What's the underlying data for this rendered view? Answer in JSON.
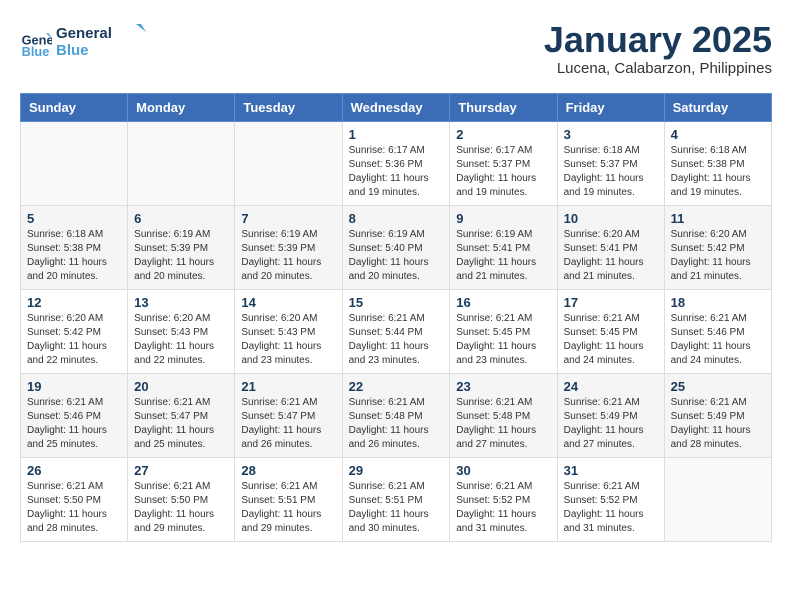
{
  "header": {
    "logo_line1": "General",
    "logo_line2": "Blue",
    "month": "January 2025",
    "location": "Lucena, Calabarzon, Philippines"
  },
  "weekdays": [
    "Sunday",
    "Monday",
    "Tuesday",
    "Wednesday",
    "Thursday",
    "Friday",
    "Saturday"
  ],
  "weeks": [
    [
      {
        "day": "",
        "sunrise": "",
        "sunset": "",
        "daylight": ""
      },
      {
        "day": "",
        "sunrise": "",
        "sunset": "",
        "daylight": ""
      },
      {
        "day": "",
        "sunrise": "",
        "sunset": "",
        "daylight": ""
      },
      {
        "day": "1",
        "sunrise": "Sunrise: 6:17 AM",
        "sunset": "Sunset: 5:36 PM",
        "daylight": "Daylight: 11 hours and 19 minutes."
      },
      {
        "day": "2",
        "sunrise": "Sunrise: 6:17 AM",
        "sunset": "Sunset: 5:37 PM",
        "daylight": "Daylight: 11 hours and 19 minutes."
      },
      {
        "day": "3",
        "sunrise": "Sunrise: 6:18 AM",
        "sunset": "Sunset: 5:37 PM",
        "daylight": "Daylight: 11 hours and 19 minutes."
      },
      {
        "day": "4",
        "sunrise": "Sunrise: 6:18 AM",
        "sunset": "Sunset: 5:38 PM",
        "daylight": "Daylight: 11 hours and 19 minutes."
      }
    ],
    [
      {
        "day": "5",
        "sunrise": "Sunrise: 6:18 AM",
        "sunset": "Sunset: 5:38 PM",
        "daylight": "Daylight: 11 hours and 20 minutes."
      },
      {
        "day": "6",
        "sunrise": "Sunrise: 6:19 AM",
        "sunset": "Sunset: 5:39 PM",
        "daylight": "Daylight: 11 hours and 20 minutes."
      },
      {
        "day": "7",
        "sunrise": "Sunrise: 6:19 AM",
        "sunset": "Sunset: 5:39 PM",
        "daylight": "Daylight: 11 hours and 20 minutes."
      },
      {
        "day": "8",
        "sunrise": "Sunrise: 6:19 AM",
        "sunset": "Sunset: 5:40 PM",
        "daylight": "Daylight: 11 hours and 20 minutes."
      },
      {
        "day": "9",
        "sunrise": "Sunrise: 6:19 AM",
        "sunset": "Sunset: 5:41 PM",
        "daylight": "Daylight: 11 hours and 21 minutes."
      },
      {
        "day": "10",
        "sunrise": "Sunrise: 6:20 AM",
        "sunset": "Sunset: 5:41 PM",
        "daylight": "Daylight: 11 hours and 21 minutes."
      },
      {
        "day": "11",
        "sunrise": "Sunrise: 6:20 AM",
        "sunset": "Sunset: 5:42 PM",
        "daylight": "Daylight: 11 hours and 21 minutes."
      }
    ],
    [
      {
        "day": "12",
        "sunrise": "Sunrise: 6:20 AM",
        "sunset": "Sunset: 5:42 PM",
        "daylight": "Daylight: 11 hours and 22 minutes."
      },
      {
        "day": "13",
        "sunrise": "Sunrise: 6:20 AM",
        "sunset": "Sunset: 5:43 PM",
        "daylight": "Daylight: 11 hours and 22 minutes."
      },
      {
        "day": "14",
        "sunrise": "Sunrise: 6:20 AM",
        "sunset": "Sunset: 5:43 PM",
        "daylight": "Daylight: 11 hours and 23 minutes."
      },
      {
        "day": "15",
        "sunrise": "Sunrise: 6:21 AM",
        "sunset": "Sunset: 5:44 PM",
        "daylight": "Daylight: 11 hours and 23 minutes."
      },
      {
        "day": "16",
        "sunrise": "Sunrise: 6:21 AM",
        "sunset": "Sunset: 5:45 PM",
        "daylight": "Daylight: 11 hours and 23 minutes."
      },
      {
        "day": "17",
        "sunrise": "Sunrise: 6:21 AM",
        "sunset": "Sunset: 5:45 PM",
        "daylight": "Daylight: 11 hours and 24 minutes."
      },
      {
        "day": "18",
        "sunrise": "Sunrise: 6:21 AM",
        "sunset": "Sunset: 5:46 PM",
        "daylight": "Daylight: 11 hours and 24 minutes."
      }
    ],
    [
      {
        "day": "19",
        "sunrise": "Sunrise: 6:21 AM",
        "sunset": "Sunset: 5:46 PM",
        "daylight": "Daylight: 11 hours and 25 minutes."
      },
      {
        "day": "20",
        "sunrise": "Sunrise: 6:21 AM",
        "sunset": "Sunset: 5:47 PM",
        "daylight": "Daylight: 11 hours and 25 minutes."
      },
      {
        "day": "21",
        "sunrise": "Sunrise: 6:21 AM",
        "sunset": "Sunset: 5:47 PM",
        "daylight": "Daylight: 11 hours and 26 minutes."
      },
      {
        "day": "22",
        "sunrise": "Sunrise: 6:21 AM",
        "sunset": "Sunset: 5:48 PM",
        "daylight": "Daylight: 11 hours and 26 minutes."
      },
      {
        "day": "23",
        "sunrise": "Sunrise: 6:21 AM",
        "sunset": "Sunset: 5:48 PM",
        "daylight": "Daylight: 11 hours and 27 minutes."
      },
      {
        "day": "24",
        "sunrise": "Sunrise: 6:21 AM",
        "sunset": "Sunset: 5:49 PM",
        "daylight": "Daylight: 11 hours and 27 minutes."
      },
      {
        "day": "25",
        "sunrise": "Sunrise: 6:21 AM",
        "sunset": "Sunset: 5:49 PM",
        "daylight": "Daylight: 11 hours and 28 minutes."
      }
    ],
    [
      {
        "day": "26",
        "sunrise": "Sunrise: 6:21 AM",
        "sunset": "Sunset: 5:50 PM",
        "daylight": "Daylight: 11 hours and 28 minutes."
      },
      {
        "day": "27",
        "sunrise": "Sunrise: 6:21 AM",
        "sunset": "Sunset: 5:50 PM",
        "daylight": "Daylight: 11 hours and 29 minutes."
      },
      {
        "day": "28",
        "sunrise": "Sunrise: 6:21 AM",
        "sunset": "Sunset: 5:51 PM",
        "daylight": "Daylight: 11 hours and 29 minutes."
      },
      {
        "day": "29",
        "sunrise": "Sunrise: 6:21 AM",
        "sunset": "Sunset: 5:51 PM",
        "daylight": "Daylight: 11 hours and 30 minutes."
      },
      {
        "day": "30",
        "sunrise": "Sunrise: 6:21 AM",
        "sunset": "Sunset: 5:52 PM",
        "daylight": "Daylight: 11 hours and 31 minutes."
      },
      {
        "day": "31",
        "sunrise": "Sunrise: 6:21 AM",
        "sunset": "Sunset: 5:52 PM",
        "daylight": "Daylight: 11 hours and 31 minutes."
      },
      {
        "day": "",
        "sunrise": "",
        "sunset": "",
        "daylight": ""
      }
    ]
  ]
}
